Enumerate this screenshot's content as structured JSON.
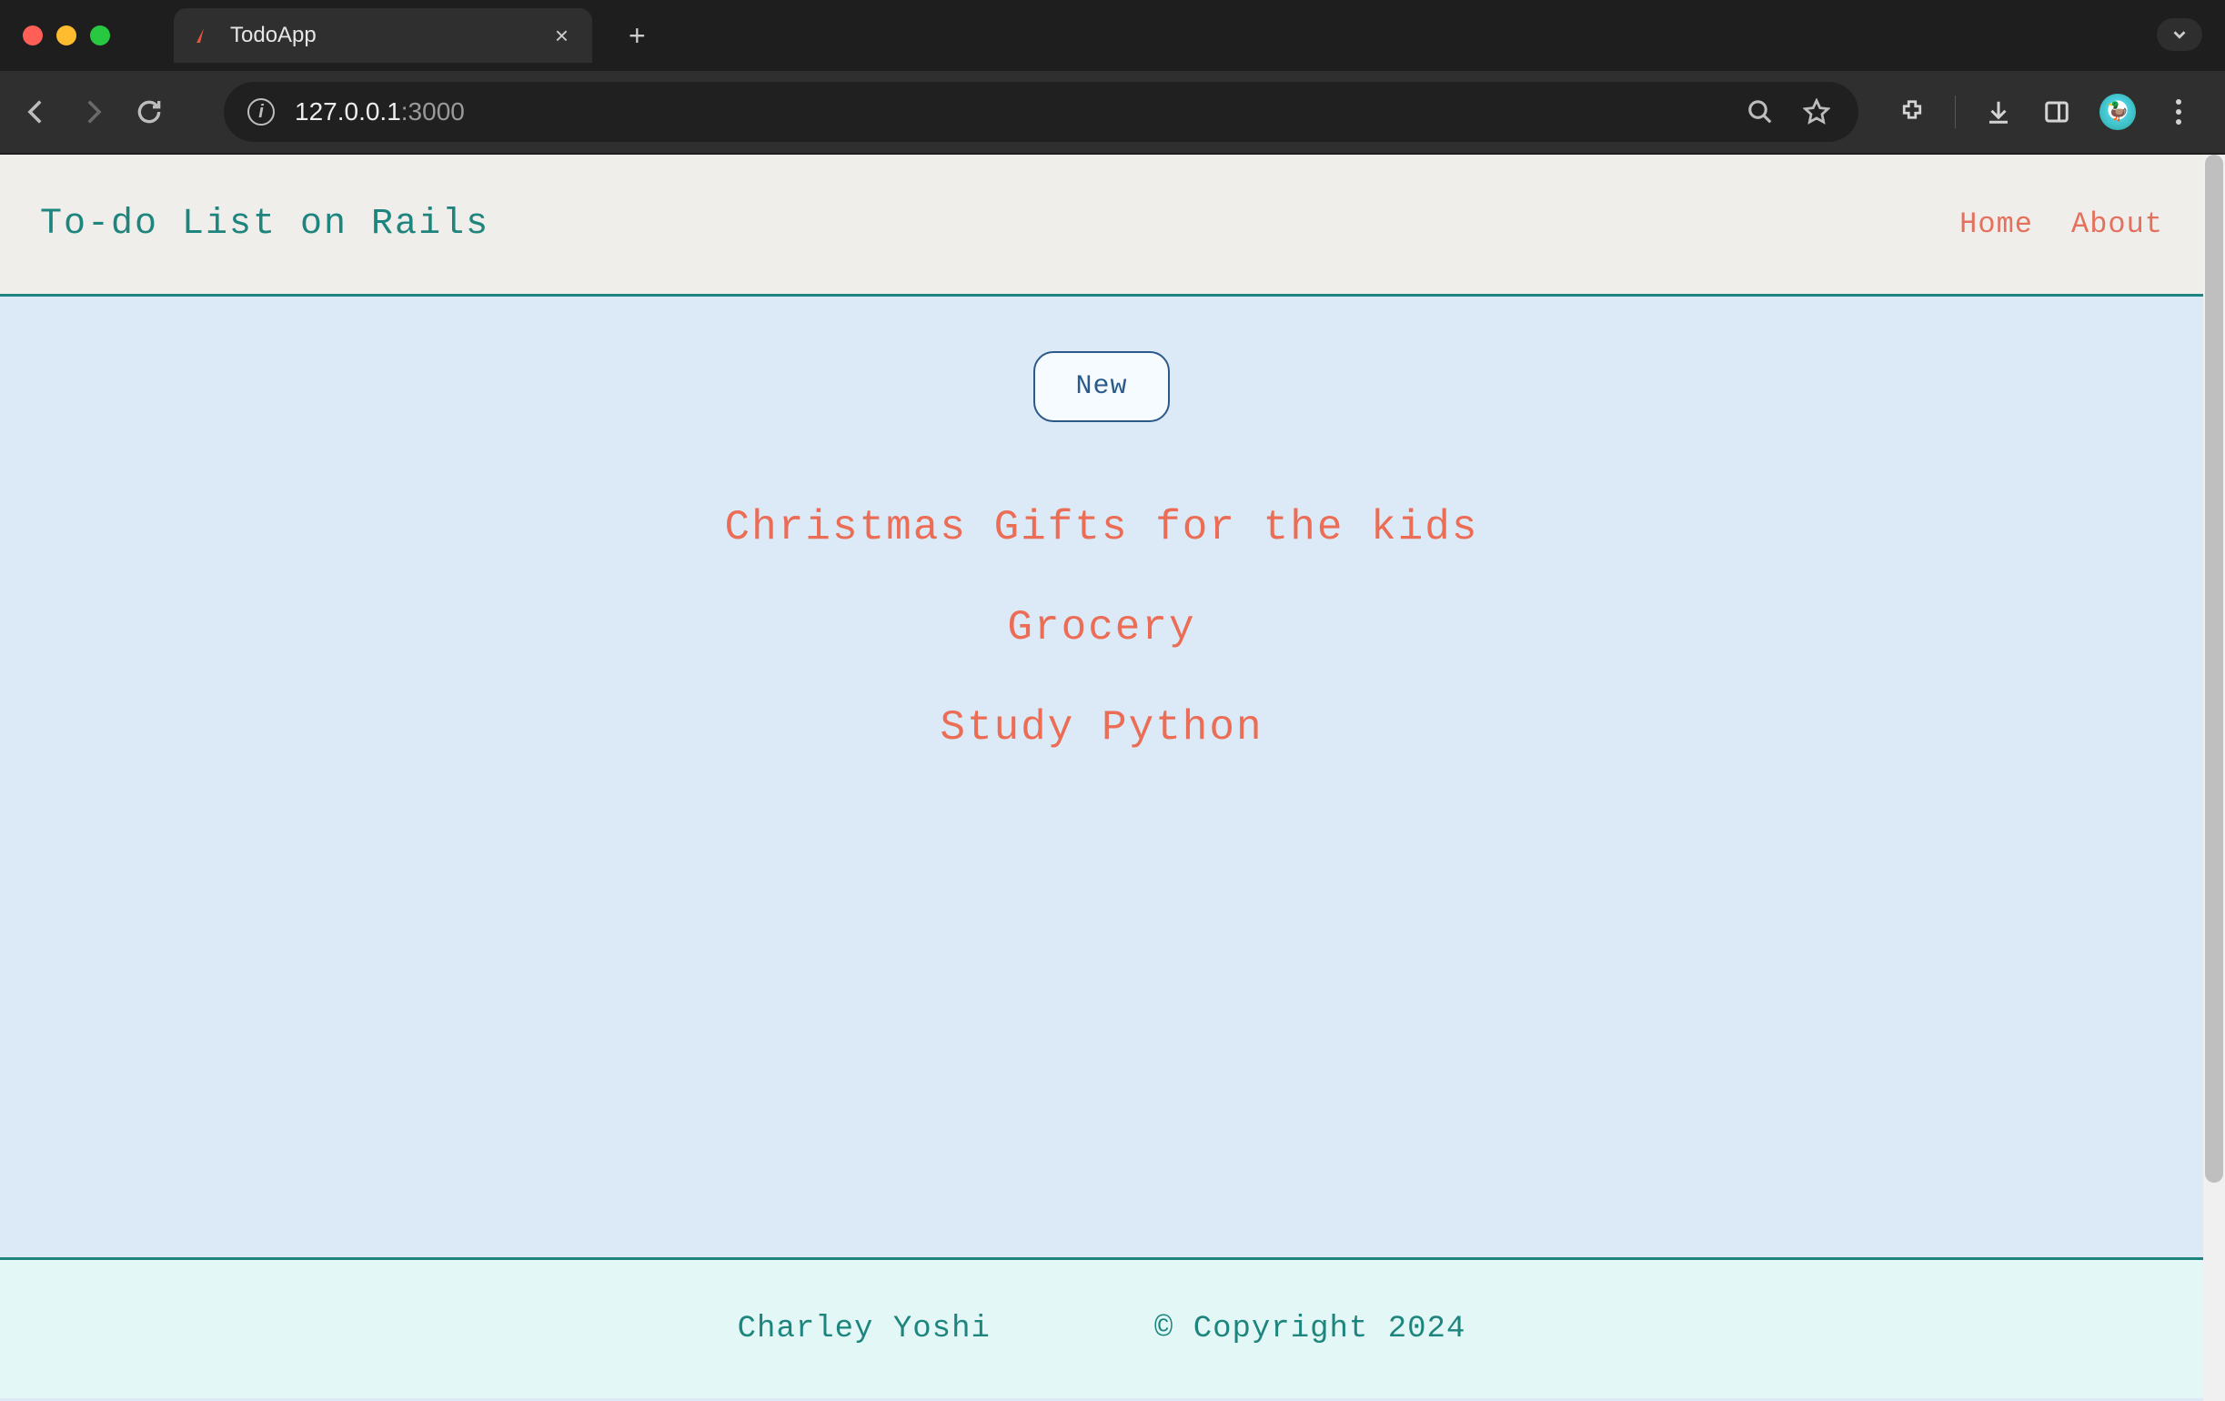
{
  "browser": {
    "tab_title": "TodoApp",
    "url_display_prefix": "127.0.0.1",
    "url_display_suffix": ":3000"
  },
  "header": {
    "title": "To-do List on Rails",
    "nav": {
      "home": "Home",
      "about": "About"
    }
  },
  "main": {
    "new_button_label": "New",
    "todos": [
      "Christmas Gifts for the kids",
      "Grocery",
      "Study Python"
    ]
  },
  "footer": {
    "author": "Charley Yoshi",
    "copyright": "© Copyright 2024"
  }
}
